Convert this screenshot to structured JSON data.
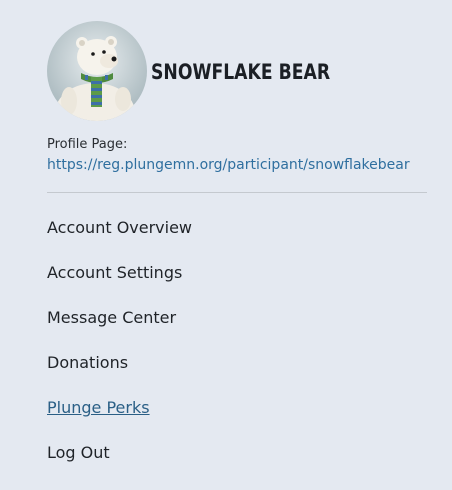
{
  "profile": {
    "display_name": "SNOWFLAKE BEAR",
    "profile_page_label": "Profile Page:",
    "profile_url": "https://reg.plungemn.org/participant/snowflakebear"
  },
  "menu": {
    "items": [
      {
        "label": "Account Overview"
      },
      {
        "label": "Account Settings"
      },
      {
        "label": "Message Center"
      },
      {
        "label": "Donations"
      },
      {
        "label": "Plunge Perks"
      },
      {
        "label": "Log Out"
      }
    ]
  },
  "colors": {
    "background": "#e4e9f1",
    "link": "#2f6f9f",
    "active_link": "#2a5f86",
    "divider": "#c4c9cf"
  }
}
